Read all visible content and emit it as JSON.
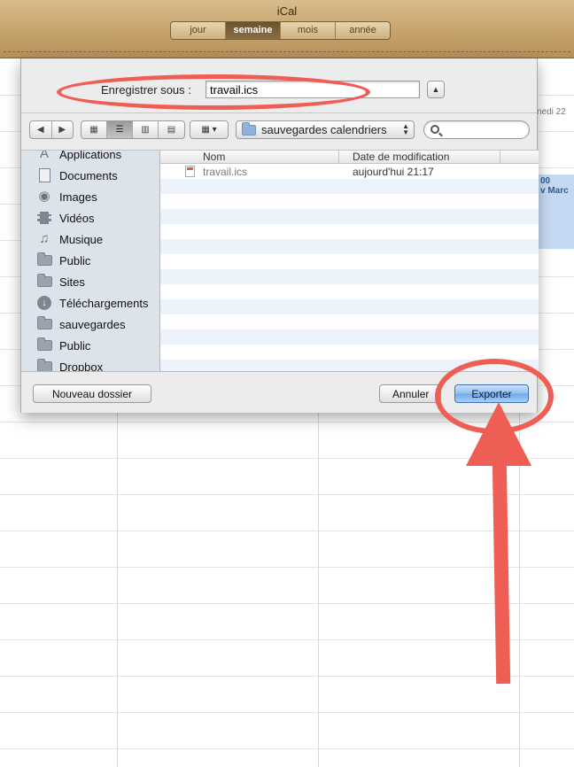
{
  "app": {
    "title": "iCal",
    "views": [
      {
        "label": "jour",
        "active": false
      },
      {
        "label": "semaine",
        "active": true
      },
      {
        "label": "mois",
        "active": false
      },
      {
        "label": "année",
        "active": false
      }
    ]
  },
  "calendar": {
    "day_header": "nedi 22",
    "event_time": "00",
    "event_title": "v Marc"
  },
  "save_dialog": {
    "save_as_label": "Enregistrer sous :",
    "filename": "travail.ics",
    "location": "sauvegardes calendriers",
    "search_placeholder": "",
    "sidebar_items": [
      {
        "label": "Applications",
        "icon": "applications-icon"
      },
      {
        "label": "Documents",
        "icon": "documents-icon"
      },
      {
        "label": "Images",
        "icon": "camera-icon"
      },
      {
        "label": "Vidéos",
        "icon": "film-icon"
      },
      {
        "label": "Musique",
        "icon": "music-note-icon"
      },
      {
        "label": "Public",
        "icon": "folder-icon"
      },
      {
        "label": "Sites",
        "icon": "folder-icon"
      },
      {
        "label": "Téléchargements",
        "icon": "download-icon"
      },
      {
        "label": "sauvegardes",
        "icon": "folder-icon"
      },
      {
        "label": "Public",
        "icon": "folder-icon"
      },
      {
        "label": "Dropbox",
        "icon": "folder-icon"
      }
    ],
    "columns": {
      "name": "Nom",
      "date": "Date de modification"
    },
    "files": [
      {
        "name": "travail.ics",
        "date": "aujourd'hui 21:17"
      }
    ],
    "buttons": {
      "new_folder": "Nouveau dossier",
      "cancel": "Annuler",
      "export": "Exporter"
    }
  },
  "colors": {
    "annotation": "#ee5e54",
    "default_button": "#8ebcf1",
    "leather": "#c9a76f"
  }
}
